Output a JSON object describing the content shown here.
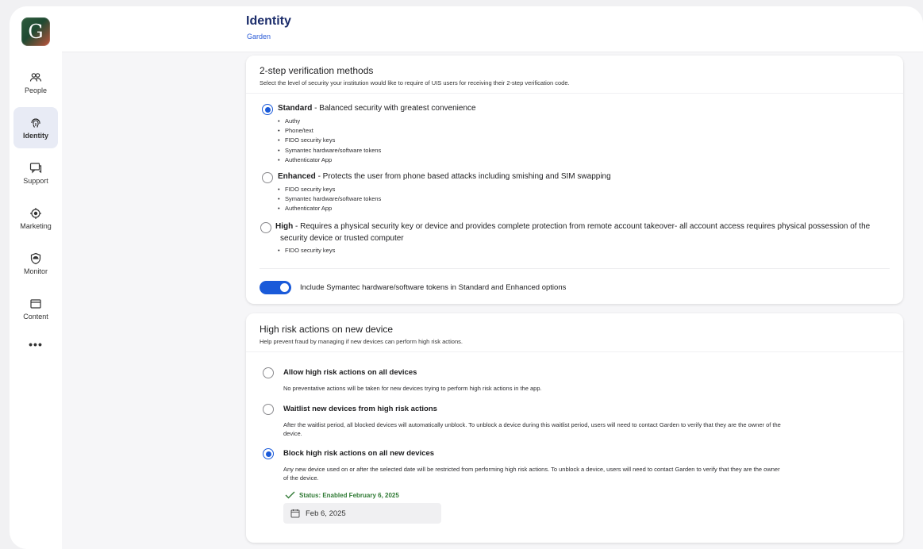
{
  "app": {
    "logo_letter": "G"
  },
  "sidebar": {
    "items": [
      {
        "label": "People",
        "icon": "people-icon",
        "active": false
      },
      {
        "label": "Identity",
        "icon": "fingerprint-icon",
        "active": true
      },
      {
        "label": "Support",
        "icon": "chat-icon",
        "active": false
      },
      {
        "label": "Marketing",
        "icon": "target-icon",
        "active": false
      },
      {
        "label": "Monitor",
        "icon": "shield-icon",
        "active": false
      },
      {
        "label": "Content",
        "icon": "window-icon",
        "active": false
      }
    ],
    "more_label": "•••"
  },
  "header": {
    "title": "Identity",
    "breadcrumb": "Garden"
  },
  "verification": {
    "title": "2-step verification methods",
    "subtitle": "Select the level of security your institution would like to require of UIS users for receiving their 2-step verification code.",
    "options": [
      {
        "name": "Standard",
        "description": " - Balanced security with greatest convenience",
        "selected": true,
        "methods": [
          "Authy",
          "Phone/text",
          "FIDO security keys",
          "Symantec hardware/software tokens",
          "Authenticator App"
        ]
      },
      {
        "name": "Enhanced",
        "description": " - Protects the user from phone based attacks including smishing and SIM swapping",
        "selected": false,
        "methods": [
          "FIDO security keys",
          "Symantec hardware/software tokens",
          "Authenticator App"
        ]
      },
      {
        "name": "High",
        "description": " - Requires a physical security key or device and provides complete protection from remote account takeover- all account access requires physical possession of the",
        "description_line2": "security device or trusted computer",
        "selected": false,
        "methods": [
          "FIDO security keys"
        ]
      }
    ],
    "toggle": {
      "label": "Include Symantec hardware/software tokens in Standard and Enhanced options",
      "on": true
    }
  },
  "high_risk": {
    "title": "High risk actions on new device",
    "subtitle": "Help prevent fraud by managing if new devices can perform high risk actions.",
    "options": [
      {
        "title": "Allow high risk actions on all devices",
        "description": "No preventative actions will be taken for new devices trying to perform high risk actions in the app.",
        "selected": false
      },
      {
        "title": "Waitlist new devices from high risk actions",
        "description": "After the waitlist period, all blocked devices will automatically unblock. To unblock a device during this waitlist period, users will need to contact Garden to verify that they are the owner of the",
        "description_line2": "device.",
        "selected": false
      },
      {
        "title": "Block high risk actions on all new devices",
        "description": "Any new device used on or after the selected date will be restricted from performing high risk actions. To unblock a device, users will need to contact Garden to verify that they are the owner",
        "description_line2": "of the device.",
        "selected": true
      }
    ],
    "status": "Status: Enabled February 6, 2025",
    "date_value": "Feb 6, 2025"
  },
  "colors": {
    "accent": "#1a5ad9",
    "title": "#1c2d6b",
    "status_green": "#2f7a34"
  }
}
